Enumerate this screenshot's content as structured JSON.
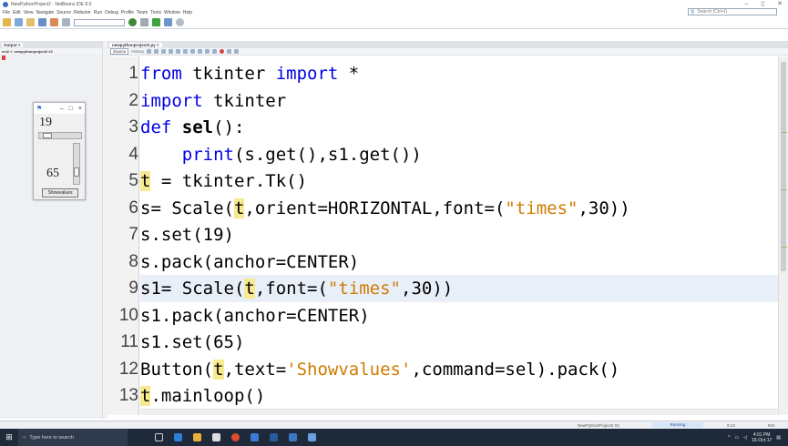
{
  "window": {
    "title": "NewPythonProject2 - NetBeans IDE 8.0",
    "controls": [
      "–",
      "▯",
      "✕"
    ]
  },
  "menu": [
    "File",
    "Edit",
    "View",
    "Navigate",
    "Source",
    "Refactor",
    "Run",
    "Debug",
    "Profile",
    "Team",
    "Tools",
    "Window",
    "Help"
  ],
  "search": {
    "placeholder": "Search (Ctrl+I)"
  },
  "output_panel": {
    "tab": "Output ×",
    "subtab_1": "ect2 ×",
    "subtab_2": "newpythonproject2 #2"
  },
  "tk_app": {
    "titlebar_icon": "feather-icon",
    "controls": [
      "–",
      "□",
      "×"
    ],
    "scale_h_value": "19",
    "scale_v_value": "65",
    "button_label": "Showvalues"
  },
  "editor": {
    "tab": "newpythonproject2.py ×",
    "source_tab": "Source",
    "history_tab": "History"
  },
  "code_lines": [
    {
      "n": "1",
      "parts": [
        [
          "kw",
          "from"
        ],
        [
          "t",
          " tkinter "
        ],
        [
          "kw",
          "import"
        ],
        [
          "t",
          " *"
        ]
      ]
    },
    {
      "n": "2",
      "parts": [
        [
          "kw",
          "import"
        ],
        [
          "t",
          " tkinter"
        ]
      ]
    },
    {
      "n": "3",
      "parts": [
        [
          "kw",
          "def"
        ],
        [
          "t",
          " "
        ],
        [
          "b",
          "sel"
        ],
        [
          "t",
          "():"
        ]
      ]
    },
    {
      "n": "4",
      "parts": [
        [
          "t",
          "    "
        ],
        [
          "kw",
          "print"
        ],
        [
          "t",
          "(s.get(),s1.get())"
        ]
      ]
    },
    {
      "n": "5",
      "parts": [
        [
          "h",
          "t"
        ],
        [
          "t",
          " = tkinter.Tk()"
        ]
      ]
    },
    {
      "n": "6",
      "parts": [
        [
          "t",
          "s= Scale("
        ],
        [
          "h",
          "t"
        ],
        [
          "t",
          ",orient=HORIZONTAL,font=("
        ],
        [
          "s",
          "\"times\""
        ],
        [
          "t",
          ",30))"
        ]
      ]
    },
    {
      "n": "7",
      "parts": [
        [
          "t",
          "s.set(19)"
        ]
      ]
    },
    {
      "n": "8",
      "parts": [
        [
          "t",
          "s.pack(anchor=CENTER)"
        ]
      ]
    },
    {
      "n": "9",
      "parts": [
        [
          "t",
          "s1= Scale("
        ],
        [
          "h",
          "t"
        ],
        [
          "t",
          ",font=("
        ],
        [
          "s",
          "\"times\""
        ],
        [
          "t",
          ",30))"
        ]
      ]
    },
    {
      "n": "10",
      "parts": [
        [
          "t",
          "s1.pack(anchor=CENTER)"
        ]
      ]
    },
    {
      "n": "11",
      "parts": [
        [
          "t",
          "s1.set(65)"
        ]
      ]
    },
    {
      "n": "12",
      "parts": [
        [
          "t",
          "Button("
        ],
        [
          "h",
          "t"
        ],
        [
          "t",
          ",text="
        ],
        [
          "s",
          "'Showvalues'"
        ],
        [
          "t",
          ",command=sel).pack()"
        ]
      ]
    },
    {
      "n": "13",
      "parts": [
        [
          "h",
          "t"
        ],
        [
          "t",
          ".mainloop()"
        ]
      ]
    }
  ],
  "current_line": 9,
  "status": {
    "project": "NewPythonProject2 #2",
    "running": "Running",
    "position": "9:13",
    "mode": "INS"
  },
  "taskbar": {
    "search_placeholder": "Type here to search",
    "time": "4:01 PM",
    "date": "16-Oct-17"
  },
  "colors": {
    "keyword": "#0000e6",
    "string": "#ce7b00",
    "highlight": "#f7e98e",
    "current_line": "#e9eff8"
  }
}
